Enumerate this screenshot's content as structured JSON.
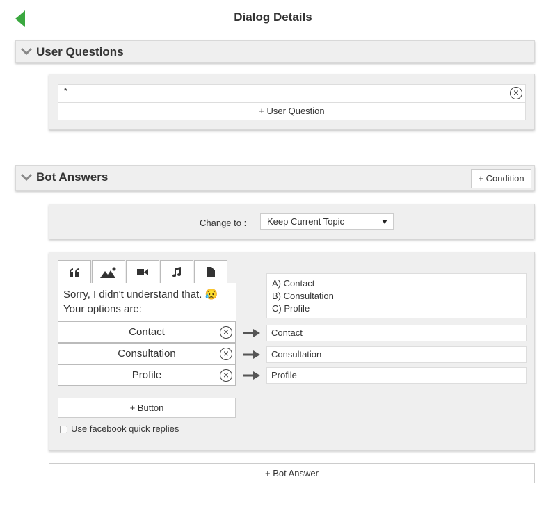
{
  "header": {
    "title": "Dialog Details",
    "back_icon": "back-arrow-icon",
    "accent": "#3aa83f"
  },
  "user_questions": {
    "title": "User Questions",
    "input_value": "*",
    "add_label": "+ User Question"
  },
  "bot_answers": {
    "title": "Bot Answers",
    "condition_label": "+ Condition",
    "change_to_label": "Change to :",
    "topic_selected": "Keep Current Topic",
    "tabs": [
      {
        "icon": "quote-icon"
      },
      {
        "icon": "image-icon"
      },
      {
        "icon": "video-icon"
      },
      {
        "icon": "music-icon"
      },
      {
        "icon": "file-icon"
      }
    ],
    "message_line1": "Sorry, I didn't understand that. 😥",
    "message_line2": "Your options are:",
    "options_text": [
      "A) Contact",
      "B) Consultation",
      "C) Profile"
    ],
    "buttons": [
      {
        "label": "Contact",
        "target": "Contact"
      },
      {
        "label": "Consultation",
        "target": "Consultation"
      },
      {
        "label": "Profile",
        "target": "Profile"
      }
    ],
    "add_button_label": "+ Button",
    "fb_quick_replies_label": "Use facebook quick replies",
    "fb_quick_replies_checked": false,
    "add_bot_answer_label": "+ Bot Answer"
  }
}
